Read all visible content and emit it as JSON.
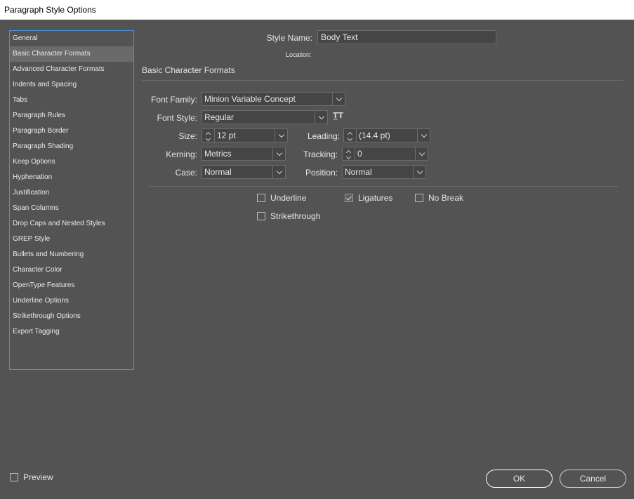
{
  "window": {
    "title": "Paragraph Style Options"
  },
  "sidebar": {
    "items": [
      {
        "label": "General"
      },
      {
        "label": "Basic Character Formats"
      },
      {
        "label": "Advanced Character Formats"
      },
      {
        "label": "Indents and Spacing"
      },
      {
        "label": "Tabs"
      },
      {
        "label": "Paragraph Rules"
      },
      {
        "label": "Paragraph Border"
      },
      {
        "label": "Paragraph Shading"
      },
      {
        "label": "Keep Options"
      },
      {
        "label": "Hyphenation"
      },
      {
        "label": "Justification"
      },
      {
        "label": "Span Columns"
      },
      {
        "label": "Drop Caps and Nested Styles"
      },
      {
        "label": "GREP Style"
      },
      {
        "label": "Bullets and Numbering"
      },
      {
        "label": "Character Color"
      },
      {
        "label": "OpenType Features"
      },
      {
        "label": "Underline Options"
      },
      {
        "label": "Strikethrough Options"
      },
      {
        "label": "Export Tagging"
      }
    ],
    "selected": "Basic Character Formats"
  },
  "header": {
    "style_name_label": "Style Name:",
    "style_name_value": "Body Text",
    "location_label": "Location:"
  },
  "section": {
    "title": "Basic Character Formats"
  },
  "fields": {
    "font_family": {
      "label": "Font Family:",
      "value": "Minion Variable Concept"
    },
    "font_style": {
      "label": "Font Style:",
      "value": "Regular"
    },
    "size": {
      "label": "Size:",
      "value": "12 pt"
    },
    "leading": {
      "label": "Leading:",
      "value": "(14.4 pt)"
    },
    "kerning": {
      "label": "Kerning:",
      "value": "Metrics"
    },
    "tracking": {
      "label": "Tracking:",
      "value": "0"
    },
    "case": {
      "label": "Case:",
      "value": "Normal"
    },
    "position": {
      "label": "Position:",
      "value": "Normal"
    }
  },
  "options": {
    "underline": {
      "label": "Underline",
      "checked": false
    },
    "ligatures": {
      "label": "Ligatures",
      "checked": true
    },
    "no_break": {
      "label": "No Break",
      "checked": false
    },
    "strikethrough": {
      "label": "Strikethrough",
      "checked": false
    }
  },
  "footer": {
    "preview_label": "Preview",
    "preview_checked": false,
    "ok_label": "OK",
    "cancel_label": "Cancel"
  },
  "colors": {
    "background": "#535353",
    "selection": "#6a6a6a",
    "focus_border": "#4a90d9"
  }
}
